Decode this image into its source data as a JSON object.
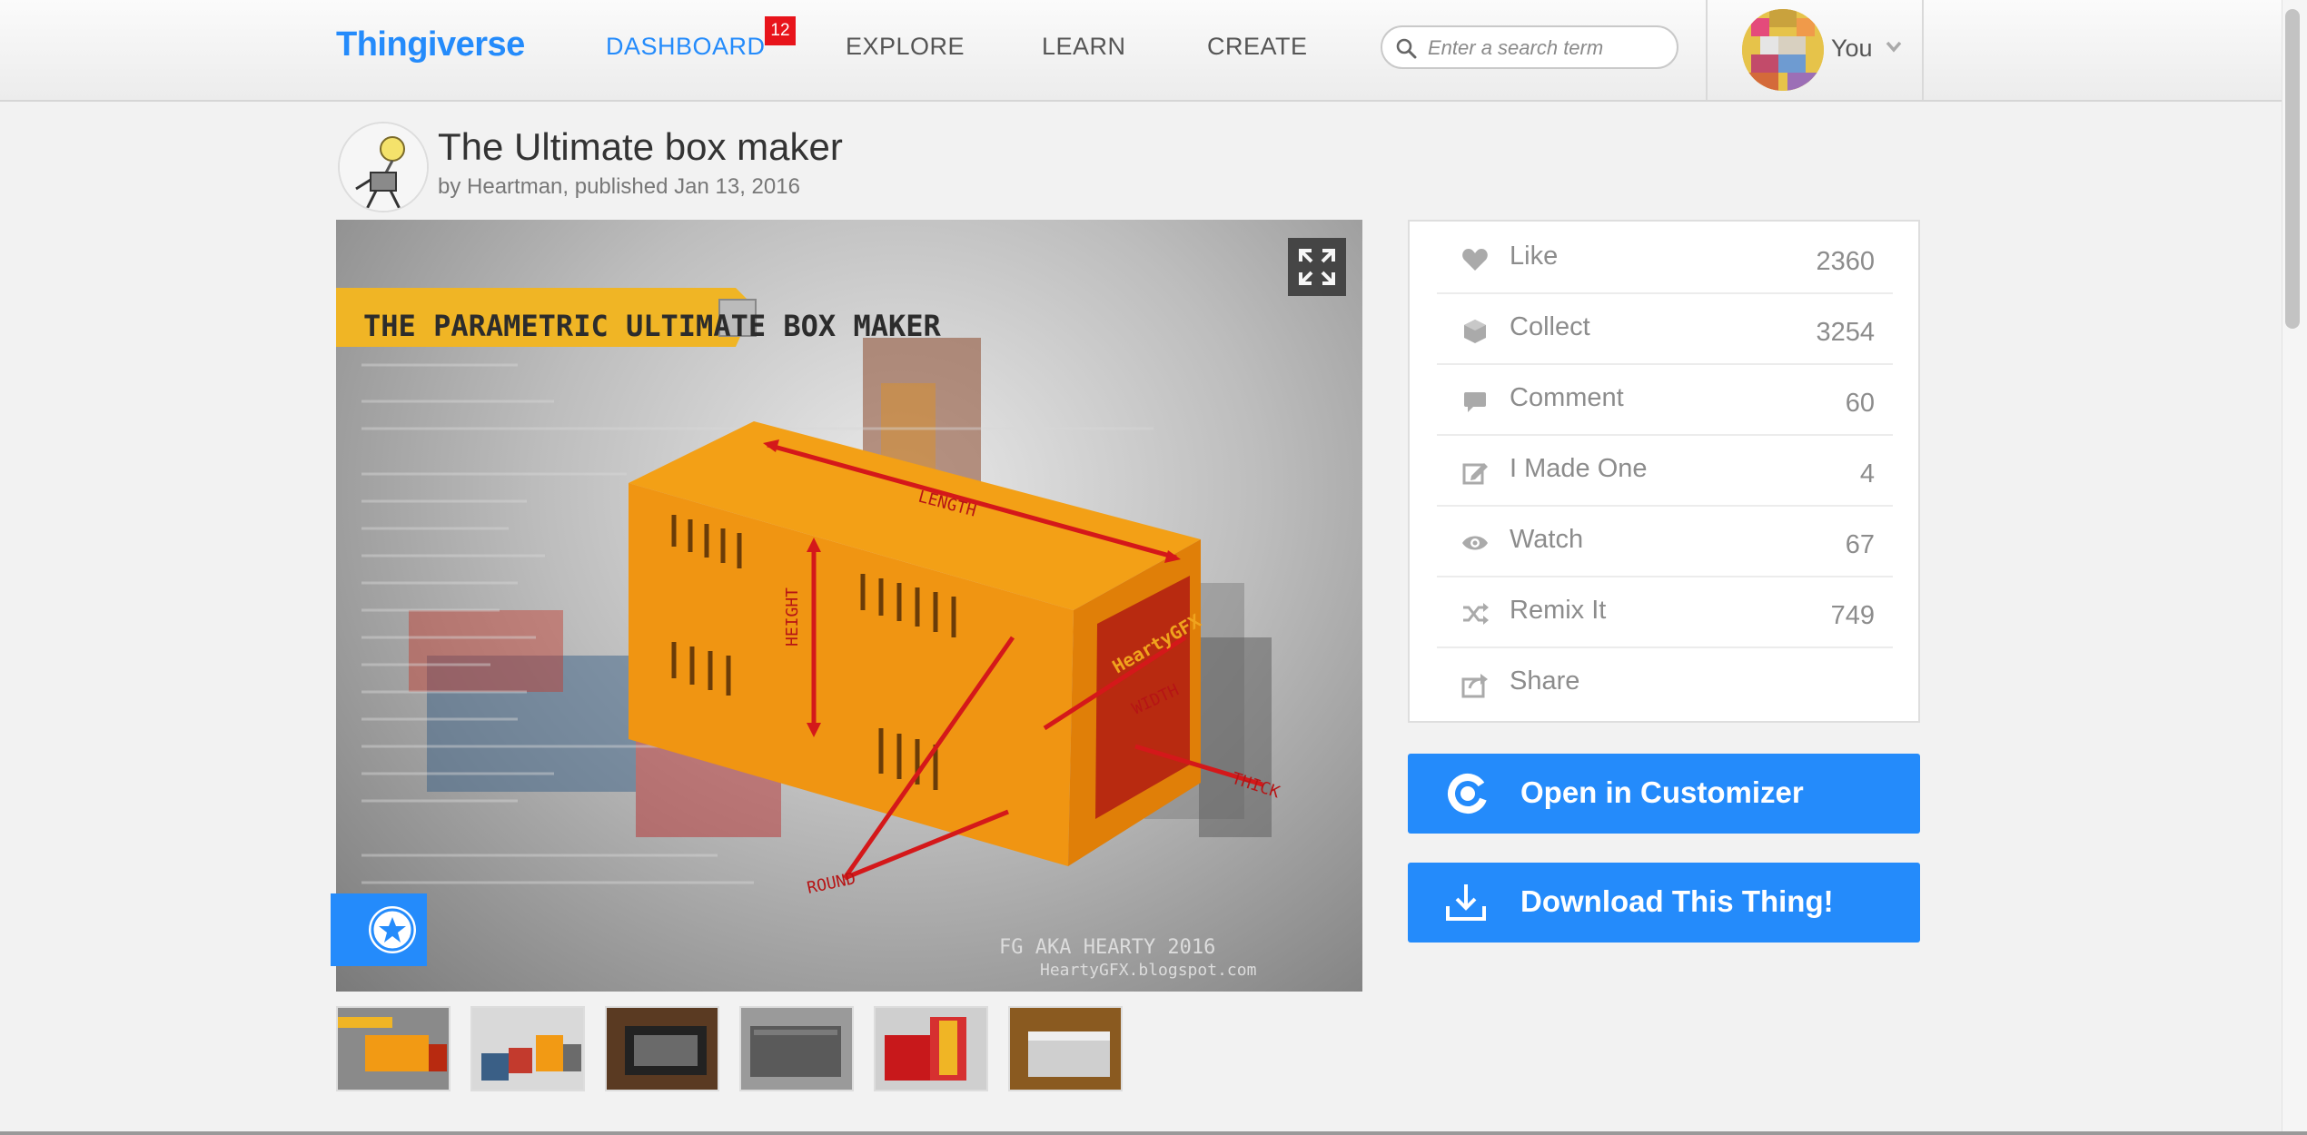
{
  "brand": {
    "name": "Thingiverse",
    "accent": "#248bfb"
  },
  "nav": {
    "items": [
      {
        "label": "DASHBOARD",
        "active": true,
        "badge": "12"
      },
      {
        "label": "EXPLORE"
      },
      {
        "label": "LEARN"
      },
      {
        "label": "CREATE"
      }
    ]
  },
  "search": {
    "placeholder": "Enter a search term",
    "icon": "search-icon"
  },
  "user": {
    "name": "You",
    "icon": "chevron-down-icon"
  },
  "thing": {
    "title": "The Ultimate box maker",
    "byline": "by Heartman, published Jan 13, 2016",
    "image_caption": "THE PARAMETRIC ULTIMATE BOX MAKER",
    "image_watermark_line1": "FG AKA HEARTY 2016",
    "image_watermark_line2": "HeartyGFX.blogspot.com",
    "image_labels": {
      "length": "LENGTH",
      "height": "HEIGHT",
      "width": "WIDTH",
      "thick": "THICK",
      "round": "ROUND",
      "maker": "HeartyGFX"
    },
    "thumbnail_count": 6
  },
  "actions": [
    {
      "label": "Like",
      "count": "2360",
      "icon": "heart-icon"
    },
    {
      "label": "Collect",
      "count": "3254",
      "icon": "collect-box-icon"
    },
    {
      "label": "Comment",
      "count": "60",
      "icon": "comment-icon"
    },
    {
      "label": "I Made One",
      "count": "4",
      "icon": "edit-pencil-icon"
    },
    {
      "label": "Watch",
      "count": "67",
      "icon": "eye-icon"
    },
    {
      "label": "Remix It",
      "count": "749",
      "icon": "shuffle-icon"
    },
    {
      "label": "Share",
      "count": "",
      "icon": "share-icon"
    }
  ],
  "buttons": {
    "customizer": "Open in Customizer",
    "download": "Download This Thing!"
  }
}
